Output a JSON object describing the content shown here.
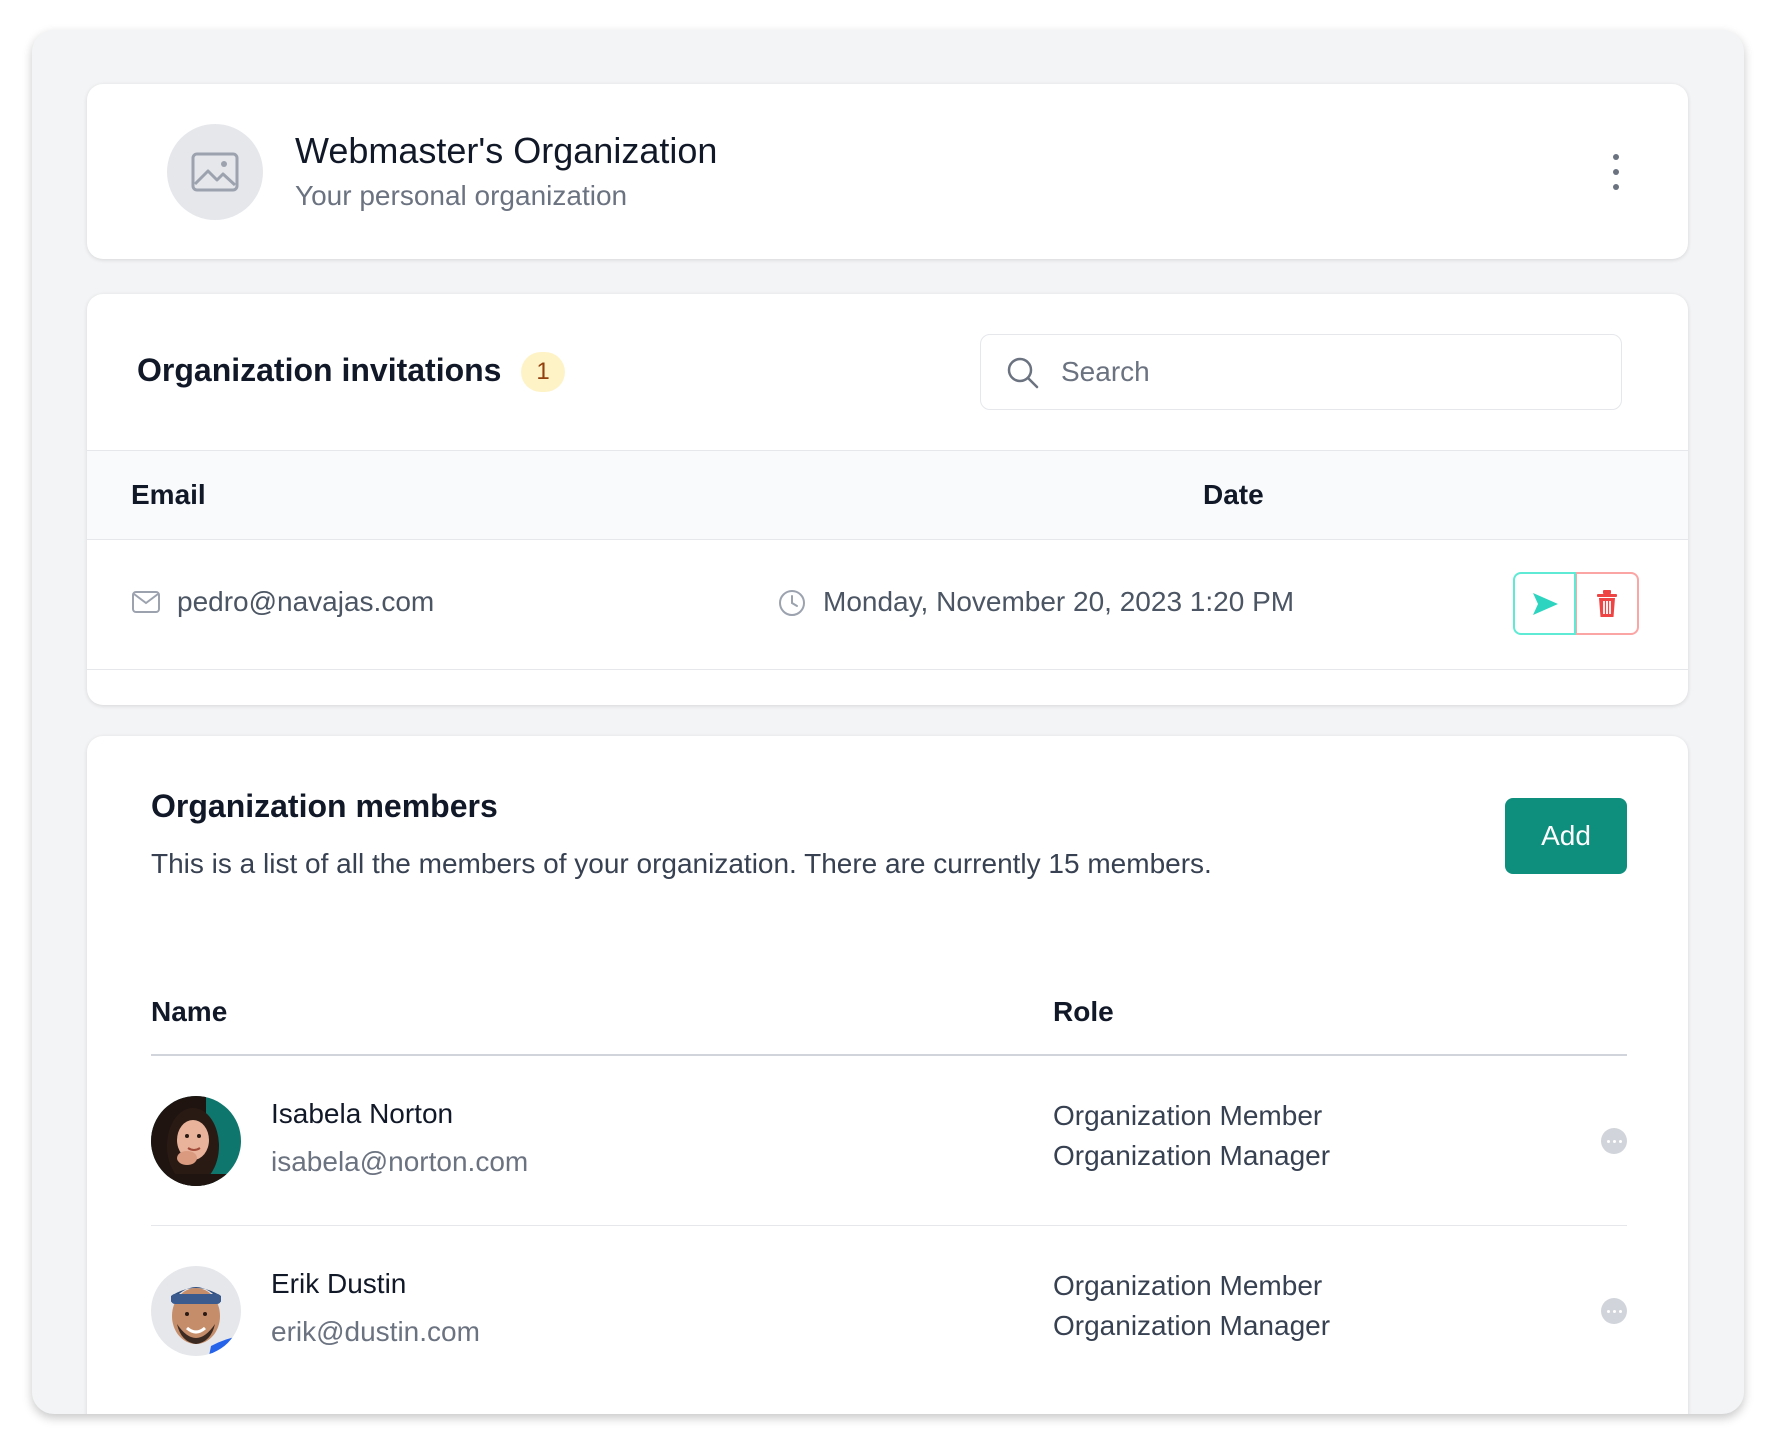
{
  "org": {
    "name": "Webmaster's Organization",
    "subtitle": "Your personal organization",
    "avatar_icon": "image-placeholder-icon",
    "menu_icon": "kebab-vertical-icon"
  },
  "invitations": {
    "title": "Organization invitations",
    "count": "1",
    "search": {
      "placeholder": "Search",
      "value": ""
    },
    "columns": {
      "email": "Email",
      "date": "Date"
    },
    "rows": [
      {
        "email": "pedro@navajas.com",
        "date": "Monday, November 20, 2023 1:20 PM"
      }
    ]
  },
  "members": {
    "title": "Organization members",
    "description": "This is a list of all the members of your organization. There are currently 15 members.",
    "add_label": "Add",
    "columns": {
      "name": "Name",
      "role": "Role"
    },
    "rows": [
      {
        "name": "Isabela Norton",
        "email": "isabela@norton.com",
        "roles": [
          "Organization Member",
          "Organization Manager"
        ]
      },
      {
        "name": "Erik Dustin",
        "email": "erik@dustin.com",
        "roles": [
          "Organization Member",
          "Organization Manager"
        ]
      }
    ]
  },
  "colors": {
    "accent": "#0e8f7e",
    "resend": "#2dd4bf",
    "delete": "#ef4444",
    "badge_bg": "#fef3c7"
  }
}
